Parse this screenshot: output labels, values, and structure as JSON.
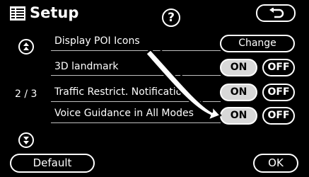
{
  "header": {
    "title": "Setup",
    "help_label": "?",
    "back_icon": "return-arrow-icon",
    "title_icon": "setup-list-icon"
  },
  "scroll": {
    "up_icon": "scroll-up-icon",
    "down_icon": "scroll-down-icon",
    "page_indicator": "2 / 3"
  },
  "rows": [
    {
      "label": "Display POI Icons",
      "button": "Change"
    },
    {
      "label": "3D landmark",
      "on_label": "ON",
      "off_label": "OFF"
    },
    {
      "label": "Traffic Restrict. Notification",
      "on_label": "ON",
      "off_label": "OFF"
    },
    {
      "label": "Voice Guidance in All Modes",
      "on_label": "ON",
      "off_label": "OFF"
    }
  ],
  "footer": {
    "default_label": "Default",
    "ok_label": "OK"
  },
  "colors": {
    "background": "#000000",
    "foreground": "#ffffff",
    "selected_button": "#d8d8d8"
  }
}
